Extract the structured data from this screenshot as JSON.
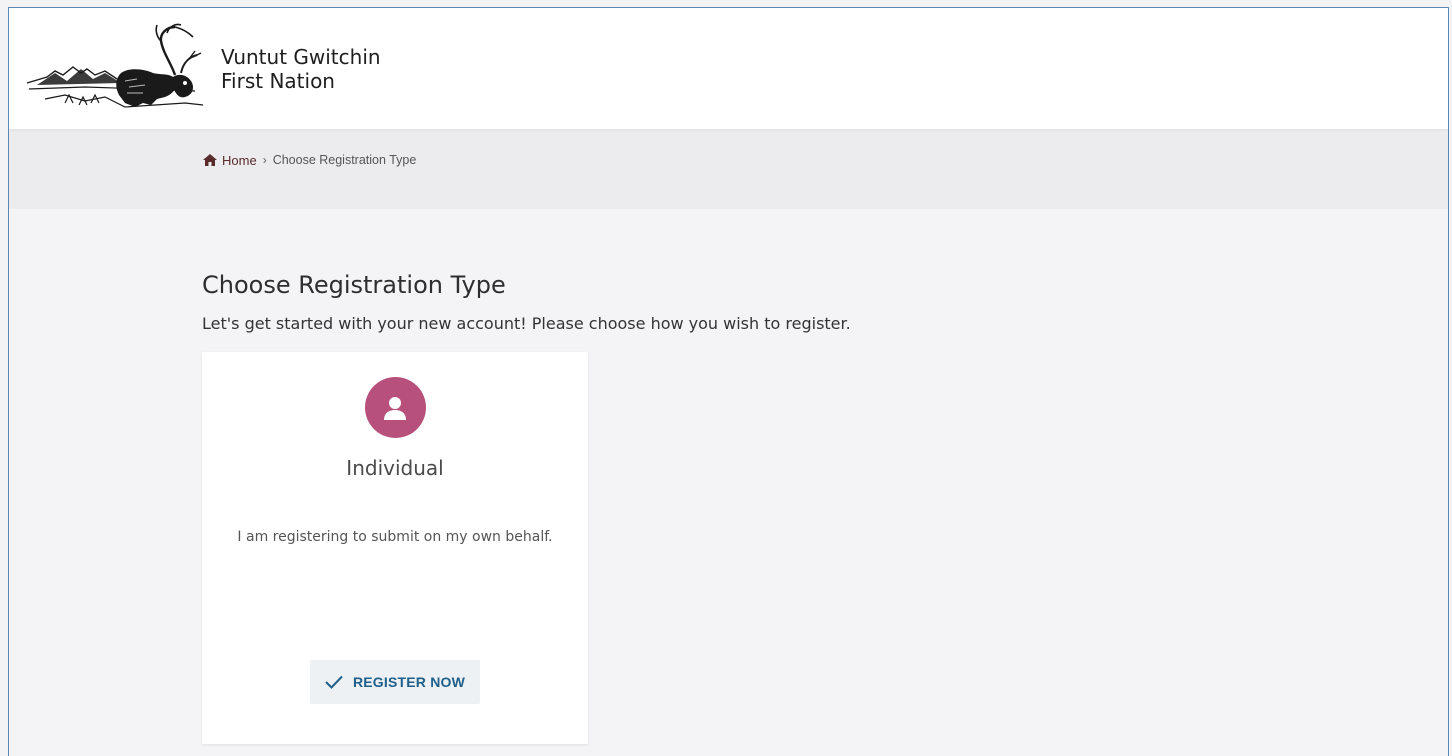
{
  "header": {
    "logo_line1": "Vuntut Gwitchin",
    "logo_line2": "First Nation"
  },
  "breadcrumb": {
    "home_label": "Home",
    "separator": "›",
    "current_label": "Choose Registration Type"
  },
  "main": {
    "title": "Choose Registration Type",
    "subtitle": "Let's get started with your new account! Please choose how you wish to register."
  },
  "card": {
    "icon": "person-icon",
    "title": "Individual",
    "description": "I am registering to submit on my own behalf.",
    "button_label": "REGISTER NOW",
    "button_icon": "checkmark-icon"
  },
  "colors": {
    "accent": "#b8507c",
    "button_text": "#1f5f8b",
    "frame_border": "#5a88b5"
  }
}
